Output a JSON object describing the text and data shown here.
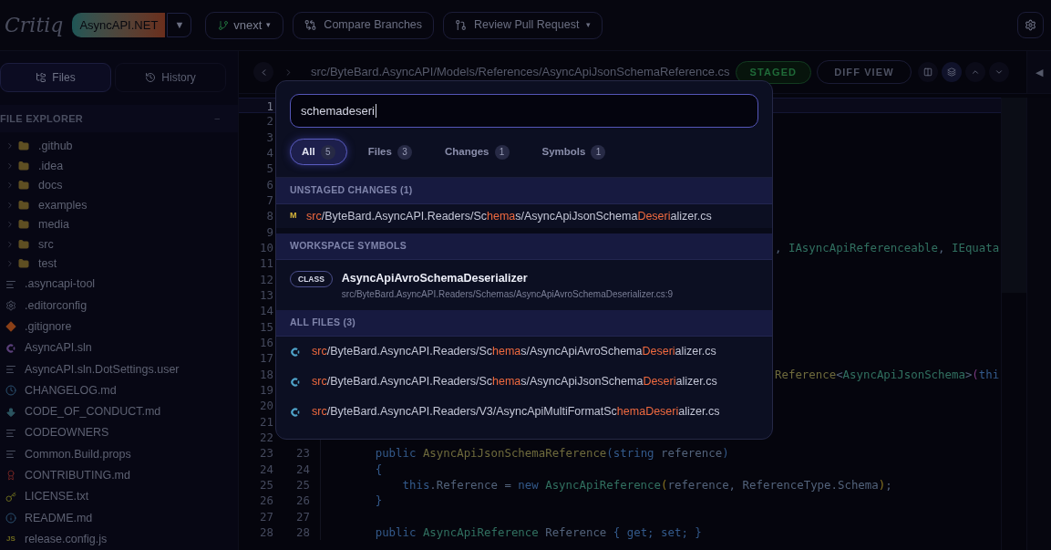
{
  "logo": "Critiq",
  "repo": {
    "name": "AsyncAPI.NET",
    "dropdown": "▼"
  },
  "branch": {
    "name": "vnext",
    "caret": "▾"
  },
  "actions": [
    {
      "kind": "compare",
      "label": "Compare Branches"
    },
    {
      "kind": "review",
      "label": "Review Pull Request",
      "caret": "▾"
    }
  ],
  "sidebar": {
    "tabs": [
      {
        "kind": "files",
        "label": "Files",
        "selected": true
      },
      {
        "kind": "history",
        "label": "History",
        "selected": false
      }
    ],
    "title": "FILE EXPLORER",
    "collapse": "–",
    "items": [
      {
        "kind": "folder",
        "name": ".github"
      },
      {
        "kind": "folder",
        "name": ".idea"
      },
      {
        "kind": "folder",
        "name": "docs"
      },
      {
        "kind": "folder",
        "name": "examples"
      },
      {
        "kind": "folder",
        "name": "media"
      },
      {
        "kind": "folder",
        "name": "src"
      },
      {
        "kind": "folder",
        "name": "test"
      },
      {
        "kind": "text",
        "name": ".asyncapi-tool"
      },
      {
        "kind": "config",
        "name": ".editorconfig"
      },
      {
        "kind": "git",
        "name": ".gitignore"
      },
      {
        "kind": "solution",
        "name": "AsyncAPI.sln"
      },
      {
        "kind": "text",
        "name": "AsyncAPI.sln.DotSettings.user"
      },
      {
        "kind": "changelog",
        "name": "CHANGELOG.md"
      },
      {
        "kind": "conduct",
        "name": "CODE_OF_CONDUCT.md"
      },
      {
        "kind": "text",
        "name": "CODEOWNERS"
      },
      {
        "kind": "text",
        "name": "Common.Build.props"
      },
      {
        "kind": "contributing",
        "name": "CONTRIBUTING.md"
      },
      {
        "kind": "license",
        "name": "LICENSE.txt"
      },
      {
        "kind": "readme",
        "name": "README.md"
      },
      {
        "kind": "script",
        "icon_text": "JS",
        "name": "release.config.js"
      }
    ]
  },
  "editor": {
    "path": "src/ByteBard.AsyncAPI/Models/References/AsyncApiJsonSchemaReference.cs",
    "status": "STAGED",
    "diff_button": "DIFF VIEW",
    "side_toggle": "◀",
    "lines": [
      {
        "n": "1",
        "current": true
      },
      {
        "n": "2",
        "current": false
      },
      {
        "n": "3",
        "current": false
      },
      {
        "n": "4",
        "current": false
      },
      {
        "n": "5",
        "current": false
      },
      {
        "n": "6",
        "current": false
      },
      {
        "n": "7",
        "current": false
      },
      {
        "n": "8",
        "current": false
      },
      {
        "n": "9",
        "current": false
      },
      {
        "n": "10",
        "current": false,
        "kind": "clipped",
        "tokens": [
          {
            "kind": "plain",
            "t": ", "
          },
          {
            "kind": "type",
            "t": "IAsyncApiReferenceable"
          },
          {
            "kind": "plain",
            "t": ", "
          },
          {
            "kind": "type",
            "t": "IEquata"
          }
        ]
      },
      {
        "n": "11",
        "current": false
      },
      {
        "n": "12",
        "current": false
      },
      {
        "n": "13",
        "current": false
      },
      {
        "n": "14",
        "current": false
      },
      {
        "n": "15",
        "current": false
      },
      {
        "n": "16",
        "current": false
      },
      {
        "n": "17",
        "current": false
      },
      {
        "n": "18",
        "current": false,
        "kind": "clipped",
        "tokens": [
          {
            "kind": "method",
            "t": "Reference"
          },
          {
            "kind": "plain",
            "t": "<"
          },
          {
            "kind": "type",
            "t": "AsyncApiJsonSchema"
          },
          {
            "kind": "plain",
            "t": ">"
          },
          {
            "kind": "bracket",
            "t": "("
          },
          {
            "kind": "kw",
            "t": "thi"
          }
        ]
      },
      {
        "n": "19",
        "current": false
      },
      {
        "n": "20",
        "current": false
      },
      {
        "n": "21",
        "current": false
      },
      {
        "n": "22",
        "current": false
      },
      {
        "n": "23",
        "n2": "23",
        "current": false,
        "kind": "full",
        "tokens": [
          {
            "kind": "kw",
            "t": "        public "
          },
          {
            "kind": "method",
            "t": "AsyncApiJsonSchemaReference"
          },
          {
            "kind": "kw",
            "t": "(string"
          },
          {
            "kind": "plain",
            "t": " reference"
          },
          {
            "kind": "kw",
            "t": ")"
          }
        ]
      },
      {
        "n": "24",
        "n2": "24",
        "current": false,
        "kind": "full",
        "tokens": [
          {
            "kind": "kw",
            "t": "        {"
          }
        ]
      },
      {
        "n": "25",
        "n2": "25",
        "current": false,
        "kind": "full",
        "tokens": [
          {
            "kind": "kw",
            "t": "            this"
          },
          {
            "kind": "plain",
            "t": ".Reference = "
          },
          {
            "kind": "kw",
            "t": "new "
          },
          {
            "kind": "type",
            "t": "AsyncApiReference"
          },
          {
            "kind": "paren",
            "t": "("
          },
          {
            "kind": "plain",
            "t": "reference, ReferenceType.Schema"
          },
          {
            "kind": "paren",
            "t": ")"
          },
          {
            "kind": "plain",
            "t": ";"
          }
        ]
      },
      {
        "n": "26",
        "n2": "26",
        "current": false,
        "kind": "full",
        "tokens": [
          {
            "kind": "kw",
            "t": "        }"
          }
        ]
      },
      {
        "n": "27",
        "n2": "27",
        "current": false,
        "kind": "full"
      },
      {
        "n": "28",
        "n2": "28",
        "current": false,
        "kind": "full",
        "tokens": [
          {
            "kind": "kw",
            "t": "        public "
          },
          {
            "kind": "type",
            "t": "AsyncApiReference"
          },
          {
            "kind": "plain",
            "t": " Reference "
          },
          {
            "kind": "kw",
            "t": "{ get; set; }"
          }
        ]
      }
    ]
  },
  "search": {
    "value": "schemadeseri",
    "filters": [
      {
        "label": "All",
        "count": "5",
        "selected": true
      },
      {
        "label": "Files",
        "count": "3",
        "selected": false
      },
      {
        "label": "Changes",
        "count": "1",
        "selected": false
      },
      {
        "label": "Symbols",
        "count": "1",
        "selected": false
      }
    ],
    "sections": [
      {
        "kind": "changes",
        "title": "UNSTAGED CHANGES (1)",
        "items": [
          {
            "status": "M",
            "path": [
              {
                "t": "src",
                "m": true
              },
              {
                "t": "/ByteBard.AsyncAPI.Readers/Sc",
                "m": false
              },
              {
                "t": "hema",
                "m": true
              },
              {
                "t": "s/AsyncApiJsonSchema",
                "m": false
              },
              {
                "t": "Deseri",
                "m": true
              },
              {
                "t": "alizer.cs",
                "m": false
              }
            ]
          }
        ]
      },
      {
        "kind": "symbols",
        "title": "WORKSPACE SYMBOLS",
        "items": [
          {
            "type": "CLASS",
            "name": "AsyncApiAvroSchemaDeserializer",
            "location": "src/ByteBard.AsyncAPI.Readers/Schemas/AsyncApiAvroSchemaDeserializer.cs:9"
          }
        ]
      },
      {
        "kind": "files",
        "title": "ALL FILES (3)",
        "items": [
          {
            "path": [
              {
                "t": "src",
                "m": true
              },
              {
                "t": "/ByteBard.AsyncAPI.Readers/Sc",
                "m": false
              },
              {
                "t": "hema",
                "m": true
              },
              {
                "t": "s/AsyncApiAvroSchema",
                "m": false
              },
              {
                "t": "Deseri",
                "m": true
              },
              {
                "t": "alizer.cs",
                "m": false
              }
            ]
          },
          {
            "path": [
              {
                "t": "src",
                "m": true
              },
              {
                "t": "/ByteBard.AsyncAPI.Readers/Sc",
                "m": false
              },
              {
                "t": "hema",
                "m": true
              },
              {
                "t": "s/AsyncApiJsonSchema",
                "m": false
              },
              {
                "t": "Deseri",
                "m": true
              },
              {
                "t": "alizer.cs",
                "m": false
              }
            ]
          },
          {
            "path": [
              {
                "t": "src",
                "m": true
              },
              {
                "t": "/ByteBard.AsyncAPI.Readers/V3/AsyncApiMultiFormatSc",
                "m": false
              },
              {
                "t": "hemaDeseri",
                "m": true
              },
              {
                "t": "alizer.cs",
                "m": false
              }
            ]
          }
        ]
      }
    ]
  }
}
